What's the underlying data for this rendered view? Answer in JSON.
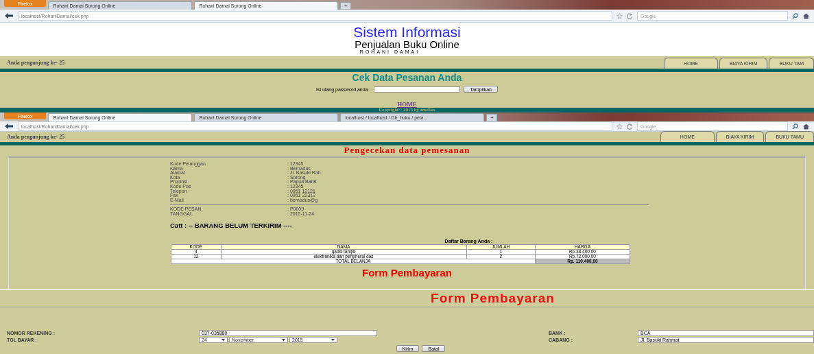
{
  "browser_1": {
    "menu_button": "Firefox",
    "tabs": [
      {
        "title": "Rohani Damai Sorong Online",
        "selected": false
      },
      {
        "title": "Rohani Damai Sorong Online",
        "selected": true
      }
    ],
    "new_tab": "+",
    "url": "localhost/RohaniDamai/cek.php",
    "search_placeholder": "Google"
  },
  "header": {
    "title": "Sistem Informasi",
    "subtitle": "Penjualan Buku Online",
    "brand": "ROHANI DAMAI"
  },
  "page_1": {
    "visitor": "Anda pengunjung ke- 25",
    "nav": [
      "HOME",
      "BIAYA KIRIM",
      "BUKU TAM"
    ],
    "heading": "Cek Data Pesanan Anda",
    "password_label": "Isi ulang password anda :",
    "button": "Tampilkan",
    "home_link": "HOME",
    "copyright": "Copyright© 2015 by amelika"
  },
  "browser_2": {
    "menu_button": "Firefox",
    "tabs": [
      {
        "title": "Rohani Damai Sorong Online",
        "selected": true
      },
      {
        "title": "Rohani Damai Sorong Online",
        "selected": false
      },
      {
        "title": "localhost / localhost / Db_buku / pela...",
        "selected": false
      }
    ],
    "new_tab": "+",
    "url": "localhost/RohaniDamai/cek.php",
    "search_placeholder": "Google"
  },
  "page_2": {
    "visitor": "Anda pengunjung ke- 25",
    "nav": [
      "HOME",
      "BIAYA KIRIM",
      "BUKU TAMU"
    ],
    "heading": "Pengecekan data pemesanan",
    "customer": [
      {
        "label": "Kode Pelanggan",
        "value": ": 12345"
      },
      {
        "label": "Nama",
        "value": ": Bernadus"
      },
      {
        "label": "Alamat",
        "value": ": Jl. Basuki Rah"
      },
      {
        "label": "Kota",
        "value": ": Sorong"
      },
      {
        "label": "Propinsi",
        "value": ": Papua Barat"
      },
      {
        "label": "Kode Pos",
        "value": ": 12345"
      },
      {
        "label": "Telepon",
        "value": ": 0951 12121"
      },
      {
        "label": "Fax",
        "value": ": 0951 22312"
      },
      {
        "label": "E-Mail",
        "value": ": bernadus@g"
      }
    ],
    "order": [
      {
        "label": "KODE PESAN",
        "value": ": P0009"
      },
      {
        "label": "TANGGAL",
        "value": ": 2015-11-24"
      }
    ],
    "note": "Catt : -- BARANG BELUM TERKIRIM ----",
    "table_title": "Daftar Barang Anda :",
    "table": {
      "columns": [
        "KODE",
        "NAMA",
        "JUMLAH",
        "HARGA"
      ],
      "rows": [
        [
          "4",
          "gadis tangsi",
          "1",
          "Rp.38.400,00"
        ],
        [
          "12",
          "elektronika dan peripheral das",
          "2",
          "Rp.72.000,00"
        ]
      ],
      "total_label": "TOTAL BELANJA",
      "total_value": "Rp. 110.400,00"
    },
    "form_heading": "Form Pembayaran"
  },
  "payment_form": {
    "title": "Form Pembayaran",
    "account": {
      "label": "NOMOR REKENING :",
      "value": "037-035880"
    },
    "bank": {
      "label": "BANK :",
      "value": "BCA"
    },
    "date": {
      "label": "TGL BAYAR :",
      "day": "24",
      "month": "November",
      "year": "2015"
    },
    "branch": {
      "label": "CABANG :",
      "value": "Jl. Basuki Rahmat"
    },
    "buttons": [
      "Kirim",
      "Batal"
    ]
  }
}
